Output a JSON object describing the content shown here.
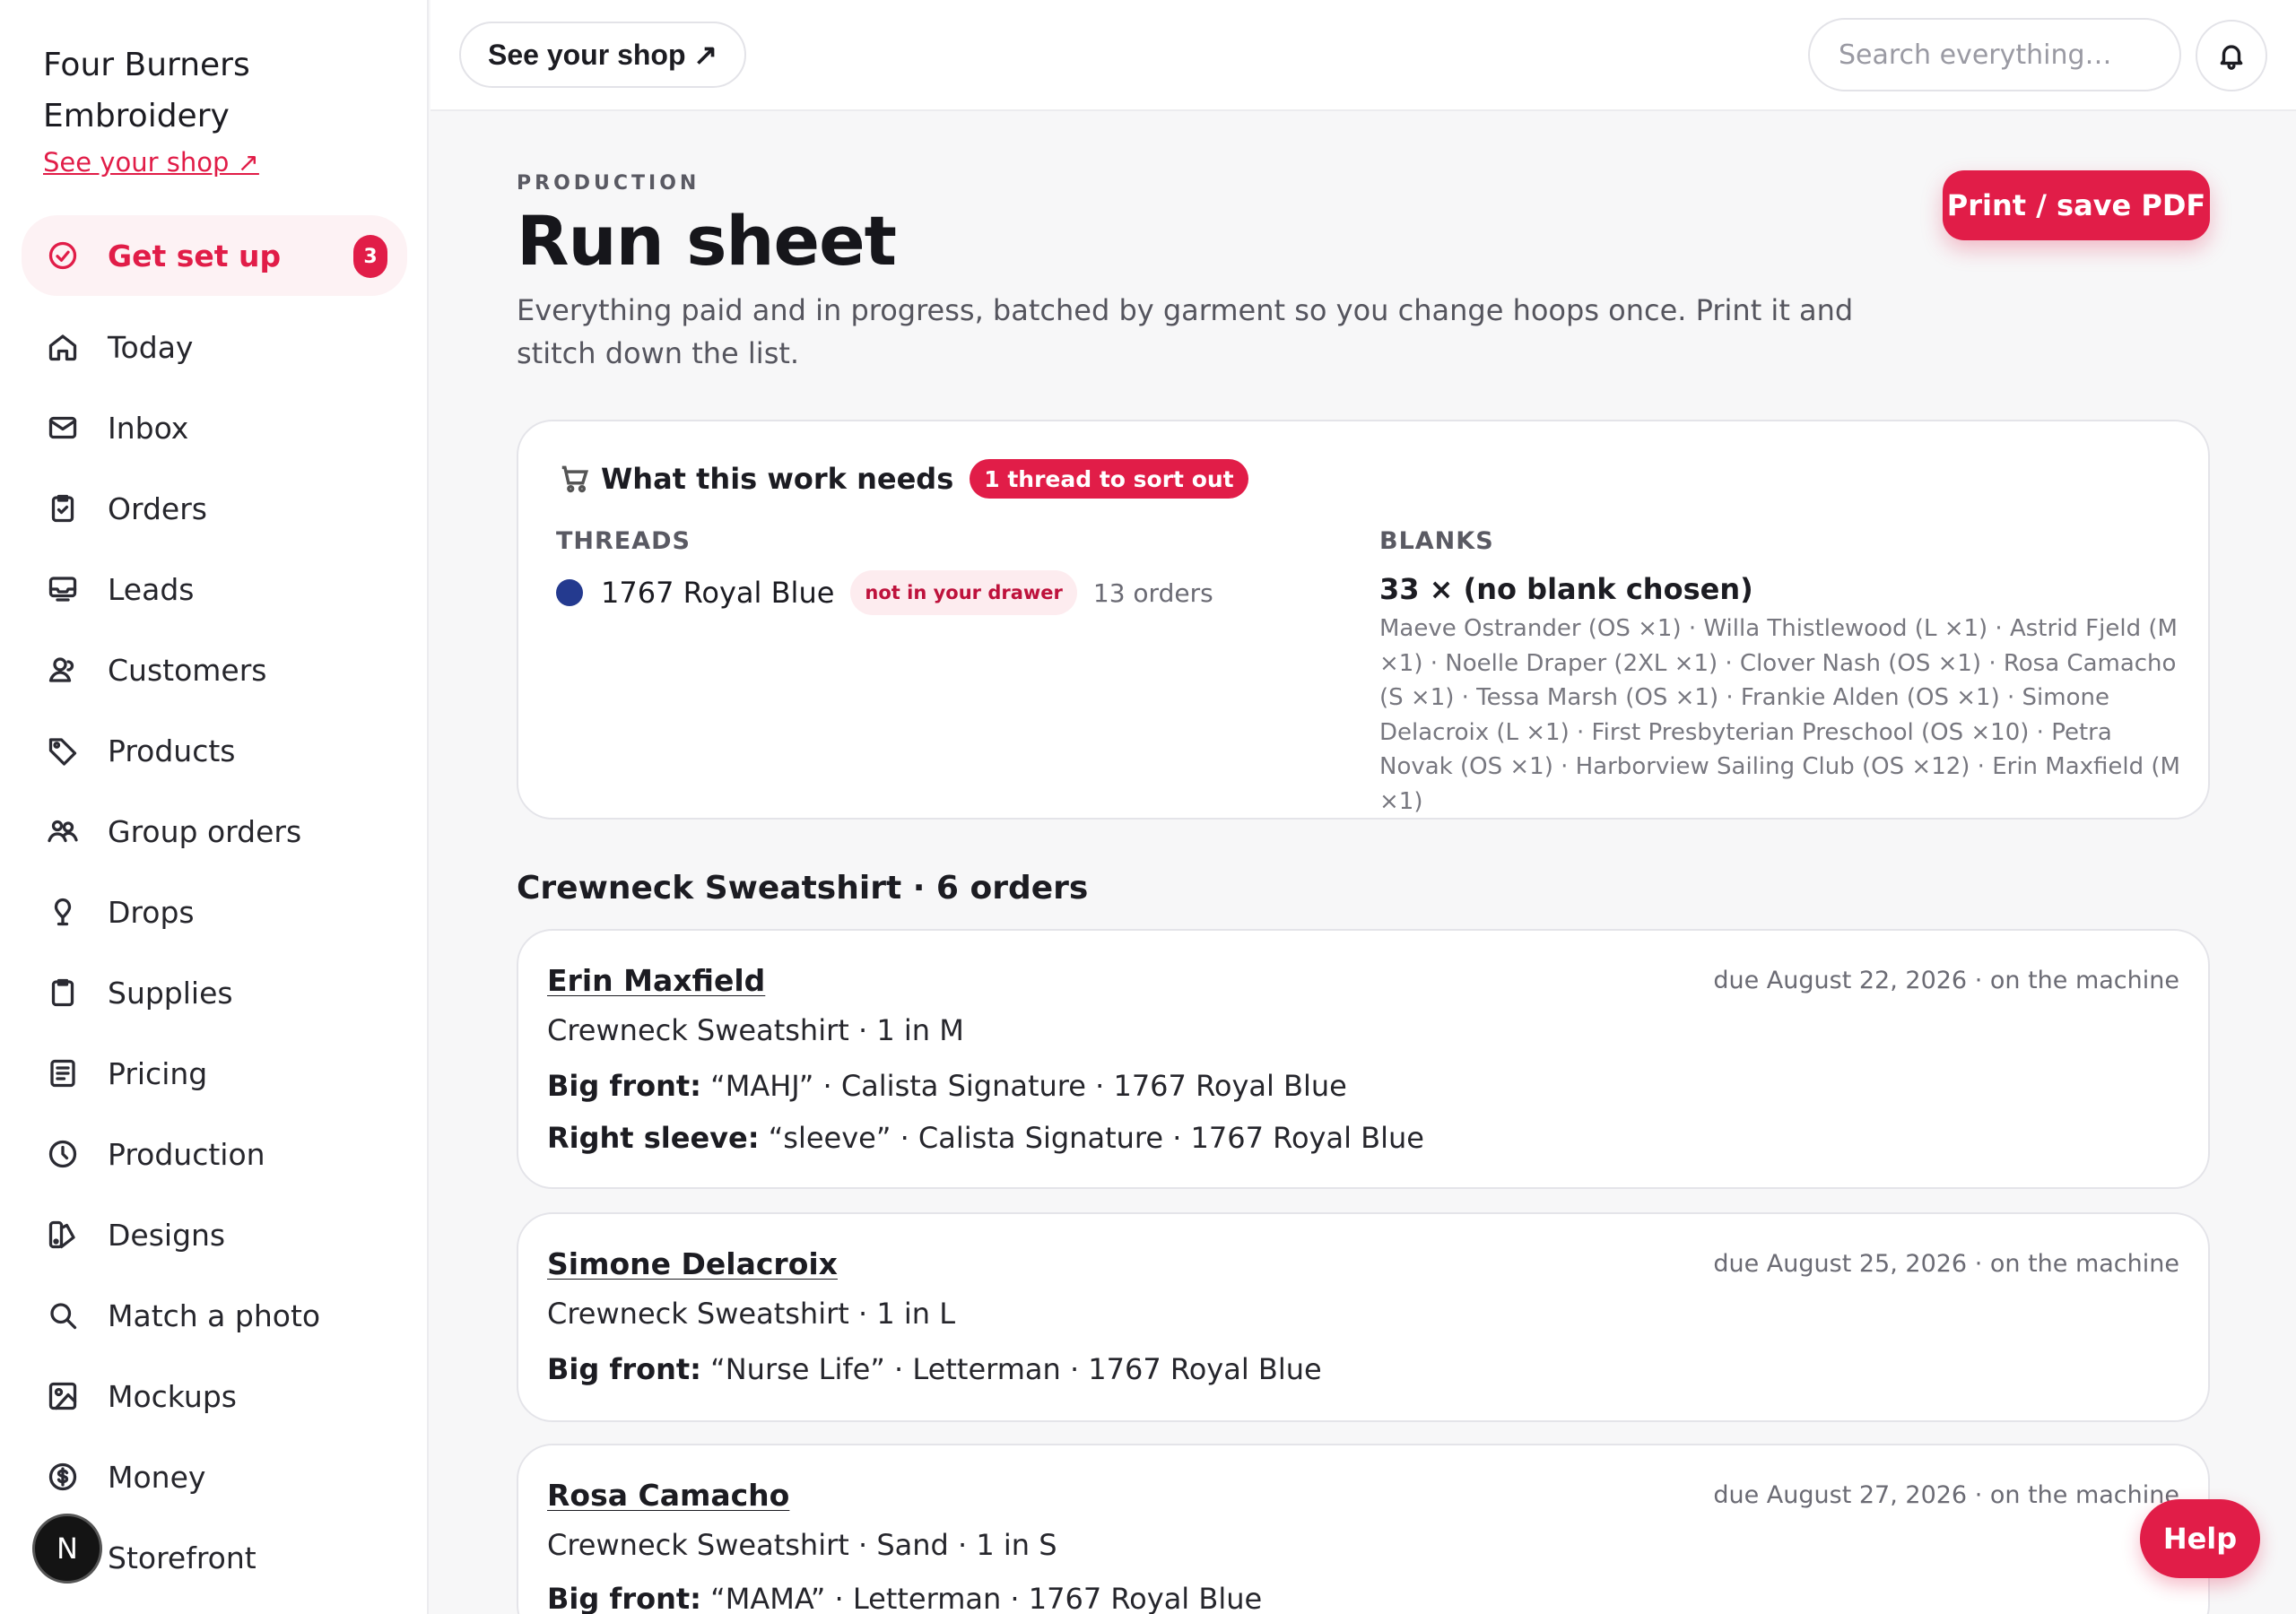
{
  "brand": {
    "name_line1": "Four Burners",
    "name_line2": "Embroidery",
    "shop_link": "See your shop ↗"
  },
  "nav": {
    "items": [
      {
        "label": "Get set up",
        "icon": "check-circle-icon",
        "badge": "3",
        "active": true
      },
      {
        "label": "Today",
        "icon": "home-icon"
      },
      {
        "label": "Inbox",
        "icon": "mail-icon"
      },
      {
        "label": "Orders",
        "icon": "clipboard-check-icon"
      },
      {
        "label": "Leads",
        "icon": "inbox-tray-icon"
      },
      {
        "label": "Customers",
        "icon": "users-icon"
      },
      {
        "label": "Products",
        "icon": "tag-icon"
      },
      {
        "label": "Group orders",
        "icon": "group-icon"
      },
      {
        "label": "Drops",
        "icon": "drop-pin-icon"
      },
      {
        "label": "Supplies",
        "icon": "clipboard-icon"
      },
      {
        "label": "Pricing",
        "icon": "document-list-icon"
      },
      {
        "label": "Production",
        "icon": "clock-icon"
      },
      {
        "label": "Designs",
        "icon": "palette-icon"
      },
      {
        "label": "Match a photo",
        "icon": "search-icon"
      },
      {
        "label": "Mockups",
        "icon": "image-icon"
      },
      {
        "label": "Money",
        "icon": "dollar-circle-icon"
      },
      {
        "label": "Storefront",
        "icon": "storefront-icon"
      }
    ],
    "n_badge": "N"
  },
  "topbar": {
    "shop_button": "See your shop ↗",
    "search_placeholder": "Search everything…"
  },
  "page": {
    "eyebrow": "PRODUCTION",
    "title": "Run sheet",
    "subtitle": "Everything paid and in progress, batched by garment so you change hoops once. Print it and stitch down the list.",
    "print_button": "Print / save PDF"
  },
  "needs": {
    "title": "What this work needs",
    "alert_pill": "1 thread to sort out",
    "threads_label": "THREADS",
    "thread": {
      "name": "1767 Royal Blue",
      "status": "not in your drawer",
      "count": "13 orders",
      "color": "#243a8f"
    },
    "blanks_label": "BLANKS",
    "blank_head": "33 × (no blank chosen)",
    "blank_list": "Maeve Ostrander (OS ×1) · Willa Thistlewood (L ×1) · Astrid Fjeld (M ×1) · Noelle Draper (2XL ×1) · Clover Nash (OS ×1) · Rosa Camacho (S ×1) · Tessa Marsh (OS ×1) · Frankie Alden (OS ×1) · Simone Delacroix (L ×1) · First Presbyterian Preschool (OS ×10) · Petra Novak (OS ×1) · Harborview Sailing Club (OS ×12) · Erin Maxfield (M ×1)"
  },
  "section": {
    "title": "Crewneck Sweatshirt · 6 orders"
  },
  "orders": [
    {
      "name": "Erin Maxfield",
      "due": "due August 22, 2026 · on the machine",
      "garment": "Crewneck Sweatshirt · 1 in M",
      "placements": [
        {
          "label": "Big front:",
          "text": "“MAHJ” · Calista Signature · 1767 Royal Blue"
        },
        {
          "label": "Right sleeve:",
          "text": "“sleeve” · Calista Signature · 1767 Royal Blue"
        }
      ]
    },
    {
      "name": "Simone Delacroix",
      "due": "due August 25, 2026 · on the machine",
      "garment": "Crewneck Sweatshirt · 1 in L",
      "placements": [
        {
          "label": "Big front:",
          "text": "“Nurse Life” · Letterman · 1767 Royal Blue"
        }
      ]
    },
    {
      "name": "Rosa Camacho",
      "due": "due August 27, 2026 · on the machine",
      "garment": "Crewneck Sweatshirt · Sand · 1 in S",
      "placements": [
        {
          "label": "Big front:",
          "text": "“MAMA” · Letterman · 1767 Royal Blue"
        }
      ]
    }
  ],
  "help_button": "Help",
  "colors": {
    "accent": "#e11d48",
    "accent_soft": "#fdecef"
  }
}
